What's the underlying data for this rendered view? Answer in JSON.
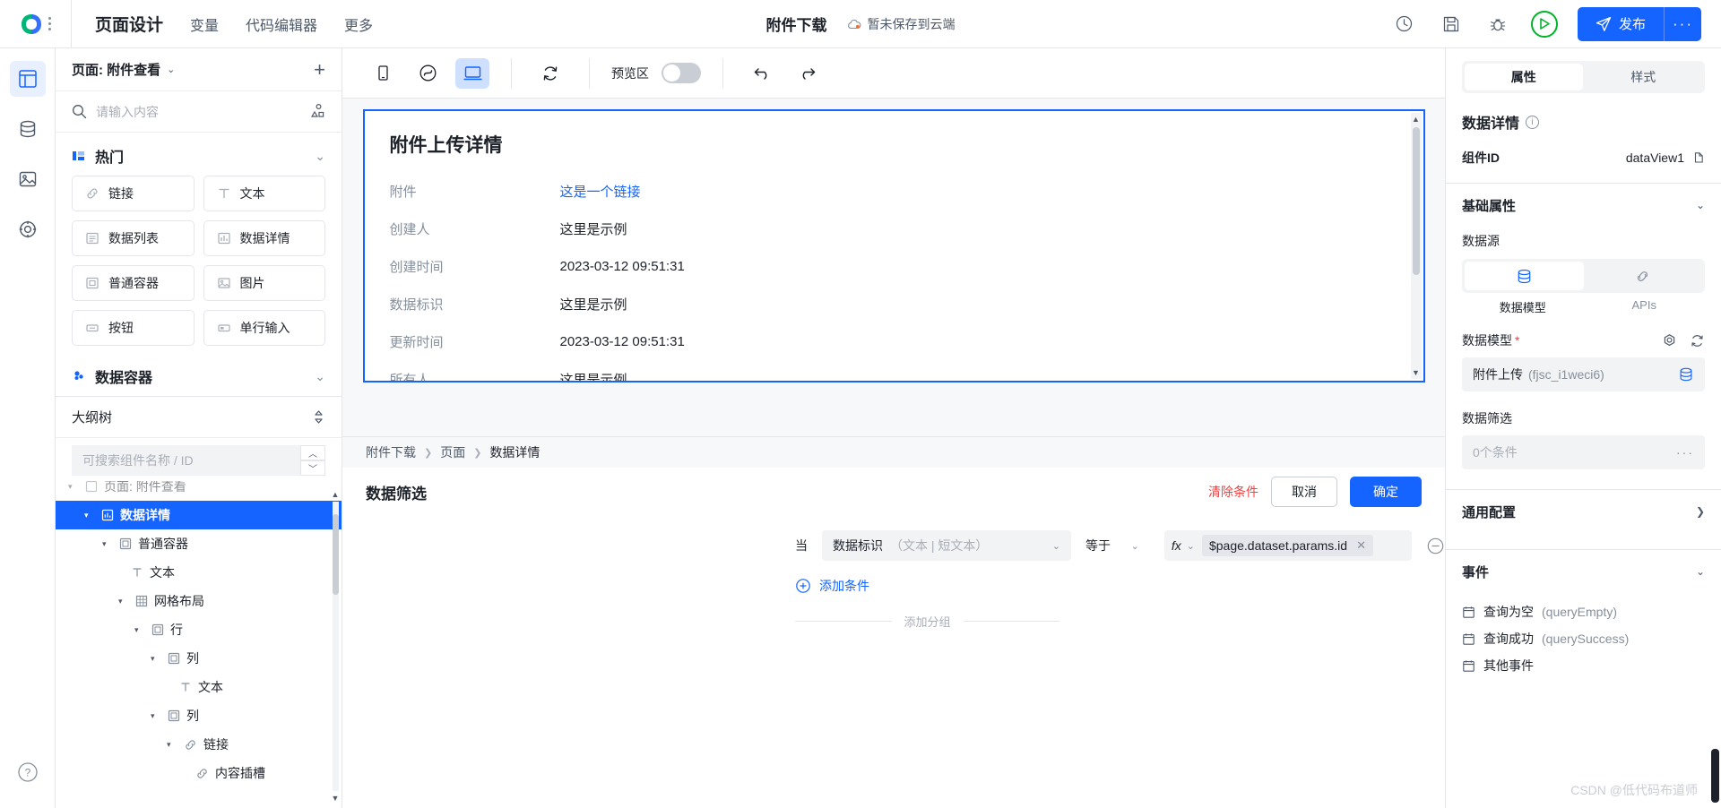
{
  "topbar": {
    "nav_tabs": [
      {
        "label": "页面设计",
        "active": true
      },
      {
        "label": "变量",
        "active": false
      },
      {
        "label": "代码编辑器",
        "active": false
      },
      {
        "label": "更多",
        "active": false
      }
    ],
    "doc_title": "附件下载",
    "save_state": "暂未保存到云端",
    "publish_label": "发布",
    "more_label": "···",
    "icons": [
      "history-icon",
      "save-icon",
      "debug-bug-icon",
      "preview-play-icon",
      "publish-send-icon",
      "more-icon"
    ]
  },
  "rail": {
    "items": [
      {
        "name": "pages-icon",
        "active": true
      },
      {
        "name": "database-icon",
        "active": false
      },
      {
        "name": "image-assets-icon",
        "active": false
      },
      {
        "name": "target-icon",
        "active": false
      }
    ],
    "help_label": "?"
  },
  "left_panel": {
    "page_label": "页面: 附件查看",
    "add_page_label": "+",
    "search_placeholder": "请输入内容",
    "search_value": "",
    "categories": [
      {
        "title": "热门",
        "expanded": true,
        "components": [
          {
            "label": "链接",
            "icon": "link-icon"
          },
          {
            "label": "文本",
            "icon": "text-icon"
          },
          {
            "label": "数据列表",
            "icon": "list-icon"
          },
          {
            "label": "数据详情",
            "icon": "detail-icon"
          },
          {
            "label": "普通容器",
            "icon": "container-icon"
          },
          {
            "label": "图片",
            "icon": "image-icon"
          },
          {
            "label": "按钮",
            "icon": "button-icon"
          },
          {
            "label": "单行输入",
            "icon": "input-icon"
          }
        ]
      },
      {
        "title": "数据容器",
        "expanded": false,
        "components": []
      }
    ],
    "outline": {
      "title": "大纲树",
      "search_placeholder": "可搜索组件名称 / ID",
      "search_value": "",
      "nodes": [
        {
          "label": "页面: 附件查看",
          "depth": 0,
          "icon": "page-icon",
          "caret": "▾",
          "selected": false
        },
        {
          "label": "数据详情",
          "depth": 1,
          "icon": "detail-icon",
          "caret": "▾",
          "selected": true
        },
        {
          "label": "普通容器",
          "depth": 2,
          "icon": "container-icon",
          "caret": "▾",
          "selected": false
        },
        {
          "label": "文本",
          "depth": 3,
          "icon": "text-icon",
          "caret": "",
          "selected": false
        },
        {
          "label": "网格布局",
          "depth": 3,
          "icon": "grid-icon",
          "caret": "▾",
          "selected": false
        },
        {
          "label": "行",
          "depth": 4,
          "icon": "container-icon",
          "caret": "▾",
          "selected": false
        },
        {
          "label": "列",
          "depth": 5,
          "icon": "container-icon",
          "caret": "▾",
          "selected": false
        },
        {
          "label": "文本",
          "depth": 6,
          "icon": "text-icon",
          "caret": "",
          "selected": false
        },
        {
          "label": "列",
          "depth": 5,
          "icon": "container-icon",
          "caret": "▾",
          "selected": false
        },
        {
          "label": "链接",
          "depth": 6,
          "icon": "link-icon",
          "caret": "▾",
          "selected": false
        },
        {
          "label": "内容插槽",
          "depth": 7,
          "icon": "link-icon",
          "caret": "",
          "selected": false
        }
      ]
    }
  },
  "canvas": {
    "toolbar": {
      "device_mobile": "mobile-icon",
      "device_miniapp": "miniprogram-icon",
      "device_desktop": "desktop-icon",
      "refresh": "refresh-icon",
      "preview_label": "预览区",
      "preview_on": false,
      "undo": "undo-icon",
      "redo": "redo-icon"
    },
    "detail_title": "附件上传详情",
    "rows": [
      {
        "label": "附件",
        "value": "这是一个链接",
        "is_link": true
      },
      {
        "label": "创建人",
        "value": "这里是示例",
        "is_link": false
      },
      {
        "label": "创建时间",
        "value": "2023-03-12 09:51:31",
        "is_link": false
      },
      {
        "label": "数据标识",
        "value": "这里是示例",
        "is_link": false
      },
      {
        "label": "更新时间",
        "value": "2023-03-12 09:51:31",
        "is_link": false
      },
      {
        "label": "所有人",
        "value": "这里是示例",
        "is_link": false
      }
    ]
  },
  "bottom_panel": {
    "breadcrumb": [
      "附件下载",
      "页面",
      "数据详情"
    ],
    "dialog_title": "数据筛选",
    "clear_label": "清除条件",
    "cancel_label": "取消",
    "confirm_label": "确定",
    "condition": {
      "when_label": "当",
      "field_label": "数据标识",
      "field_hint": "（文本 | 短文本）",
      "operator": "等于",
      "value_mode": "fx",
      "value_tag": "$page.dataset.params.id"
    },
    "add_condition_label": "添加条件",
    "add_group_label": "添加分组"
  },
  "right_panel": {
    "tabs": [
      {
        "label": "属性",
        "active": true
      },
      {
        "label": "样式",
        "active": false
      }
    ],
    "component_name": "数据详情",
    "component_id_label": "组件ID",
    "component_id_value": "dataView1",
    "sections": {
      "basic_attrs": "基础属性",
      "data_source_label": "数据源",
      "ds_tabs": [
        {
          "label": "数据模型",
          "icon": "database-icon",
          "active": true
        },
        {
          "label": "APIs",
          "icon": "api-icon",
          "active": false
        }
      ],
      "model_label": "数据模型",
      "model_required": "*",
      "model_name": "附件上传",
      "model_code": "(fjsc_i1weci6)",
      "filter_label": "数据筛选",
      "filter_value": "0个条件",
      "filter_more": "···",
      "general_config": "通用配置",
      "events_label": "事件"
    },
    "events": [
      {
        "label": "查询为空",
        "code": "(queryEmpty)"
      },
      {
        "label": "查询成功",
        "code": "(querySuccess)"
      },
      {
        "label": "其他事件",
        "code": ""
      }
    ]
  },
  "watermark": "CSDN @低代码布道师"
}
